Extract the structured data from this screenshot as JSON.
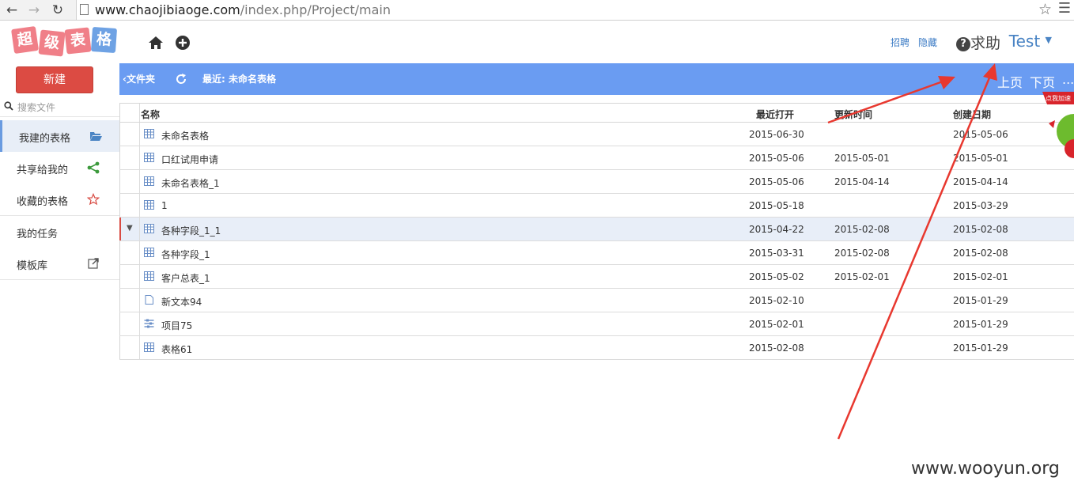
{
  "browser": {
    "url_host": "www.chaojibiaoge.com",
    "url_path": "/index.php/Project/main"
  },
  "logo": {
    "chars": [
      "超",
      "级",
      "表",
      "格"
    ]
  },
  "header": {
    "link_recruit": "招聘",
    "link_hide": "隐藏",
    "help": "求助",
    "user": "Test"
  },
  "sidebar": {
    "new_button": "新建",
    "search_placeholder": "搜索文件",
    "items": [
      {
        "label": "我建的表格",
        "icon": "folder-open-icon"
      },
      {
        "label": "共享给我的",
        "icon": "share-icon"
      },
      {
        "label": "收藏的表格",
        "icon": "star-icon"
      },
      {
        "label": "我的任务",
        "icon": ""
      },
      {
        "label": "模板库",
        "icon": "external-link-icon"
      }
    ]
  },
  "toolbar": {
    "folder": "文件夹",
    "recent": "最近: 未命名表格",
    "prev": "上页",
    "next": "下页",
    "more": "..."
  },
  "table": {
    "headers": {
      "name": "名称",
      "last_open": "最近打开",
      "updated": "更新时间",
      "created": "创建日期"
    },
    "rows": [
      {
        "name": "未命名表格",
        "icon": "table-icon",
        "last_open": "2015-06-30",
        "updated": "",
        "created": "2015-05-06"
      },
      {
        "name": "口红试用申请",
        "icon": "table-icon",
        "last_open": "2015-05-06",
        "updated": "2015-05-01",
        "created": "2015-05-01"
      },
      {
        "name": "未命名表格_1",
        "icon": "table-icon",
        "last_open": "2015-05-06",
        "updated": "2015-04-14",
        "created": "2015-04-14"
      },
      {
        "name": "1",
        "icon": "table-icon",
        "last_open": "2015-05-18",
        "updated": "",
        "created": "2015-03-29"
      },
      {
        "name": "各种字段_1_1",
        "icon": "table-icon",
        "last_open": "2015-04-22",
        "updated": "2015-02-08",
        "created": "2015-02-08"
      },
      {
        "name": "各种字段_1",
        "icon": "table-icon",
        "last_open": "2015-03-31",
        "updated": "2015-02-08",
        "created": "2015-02-08"
      },
      {
        "name": "客户总表_1",
        "icon": "table-icon",
        "last_open": "2015-05-02",
        "updated": "2015-02-01",
        "created": "2015-02-01"
      },
      {
        "name": "新文本94",
        "icon": "document-icon",
        "last_open": "2015-02-10",
        "updated": "",
        "created": "2015-01-29"
      },
      {
        "name": "项目75",
        "icon": "project-icon",
        "last_open": "2015-02-01",
        "updated": "",
        "created": "2015-01-29"
      },
      {
        "name": "表格61",
        "icon": "table-icon",
        "last_open": "2015-02-08",
        "updated": "",
        "created": "2015-01-29"
      }
    ],
    "selected_index": 4
  },
  "promo": {
    "text": "点我加速"
  },
  "watermark": "www.wooyun.org",
  "colors": {
    "toolbar": "#6a9cf2",
    "new_button": "#dc4b43",
    "link": "#3d7cc5",
    "annotation_arrow": "#e8382f"
  }
}
